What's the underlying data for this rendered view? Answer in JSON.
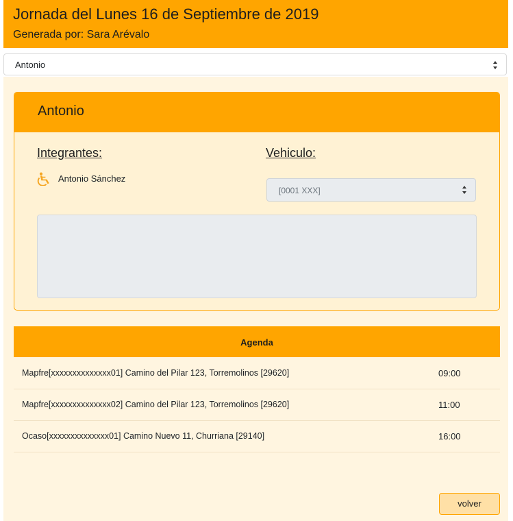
{
  "header": {
    "title": "Jornada del Lunes 16 de Septiembre de 2019",
    "subtitle": "Generada por: Sara Arévalo"
  },
  "team_select": {
    "value": "Antonio"
  },
  "card": {
    "title": "Antonio",
    "members_label": "Integrantes:",
    "vehicle_label": "Vehiculo:",
    "members": [
      {
        "name": "Antonio Sánchez",
        "icon": "wheelchair-icon"
      }
    ],
    "vehicle_value": "[0001 XXX]",
    "notes": ""
  },
  "agenda": {
    "title": "Agenda",
    "rows": [
      {
        "desc": "Mapfre[xxxxxxxxxxxxxx01] Camino del Pilar 123, Torremolinos [29620]",
        "time": "09:00"
      },
      {
        "desc": "Mapfre[xxxxxxxxxxxxxx02] Camino del Pilar 123, Torremolinos [29620]",
        "time": "11:00"
      },
      {
        "desc": "Ocaso[xxxxxxxxxxxxxx01] Camino Nuevo 11, Churriana [29140]",
        "time": "16:00"
      }
    ]
  },
  "buttons": {
    "back": "volver"
  },
  "colors": {
    "accent": "#FFA500",
    "panel": "#FFF2D4"
  }
}
